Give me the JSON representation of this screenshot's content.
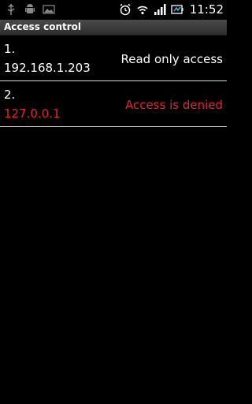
{
  "status_bar": {
    "time": "11:52",
    "left_icons": [
      "usb-debug-icon",
      "android-icon",
      "image-icon"
    ],
    "right_icons": [
      "alarm-icon",
      "wifi-icon",
      "signal-icon",
      "battery-icon"
    ]
  },
  "title_bar": {
    "title": "Access control"
  },
  "list": {
    "items": [
      {
        "index": "1.",
        "ip": "192.168.1.203",
        "status": "Read only access",
        "color": "#ffffff"
      },
      {
        "index": "2.",
        "ip": "127.0.0.1",
        "status": "Access is denied",
        "color": "#e8222e"
      }
    ]
  },
  "colors": {
    "background": "#000000",
    "denied": "#e8222e",
    "divider": "#d9d9d9"
  }
}
